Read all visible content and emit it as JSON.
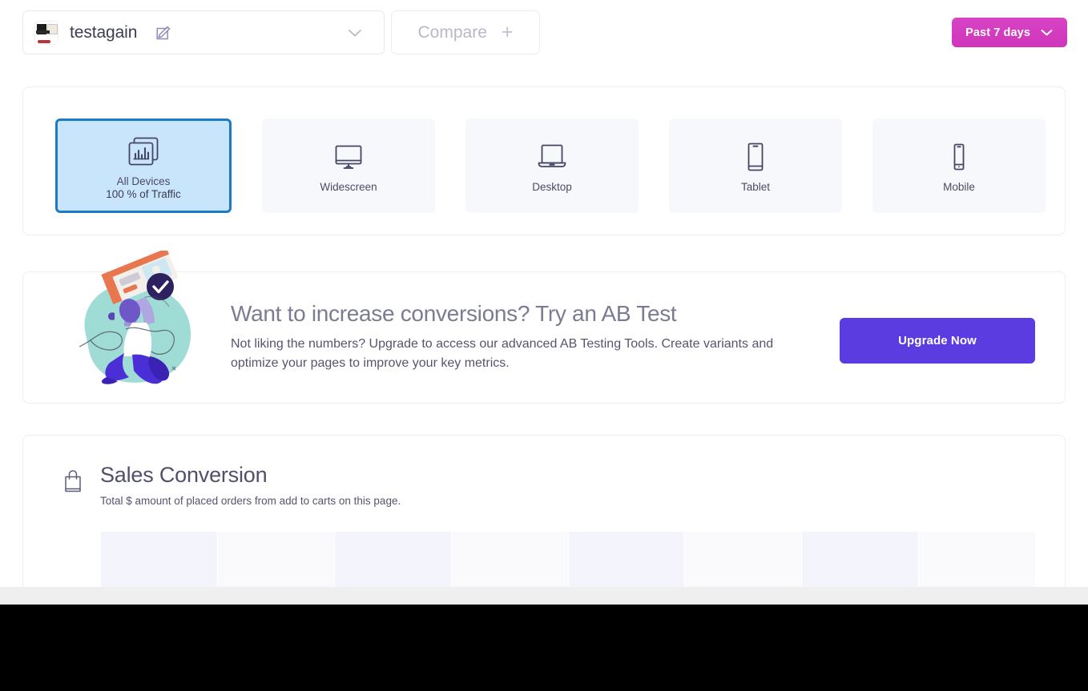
{
  "topbar": {
    "site_thumbnail_name": "site-favicon-thumbnail",
    "site_name": "testagain",
    "edit_icon": "edit-pencil-icon",
    "site_dropdown_icon": "chevron-down-icon",
    "compare_label": "Compare",
    "compare_plus": "+",
    "date_range_label": "Past 7 days",
    "date_range_icon": "chevron-down-icon",
    "date_range_color": "#d63bc2"
  },
  "devices": {
    "selected_index": 0,
    "selected_border_color": "#1f7ac4",
    "selected_background_color": "#c9e5fb",
    "tile_background_color": "#f6f8fc",
    "items": [
      {
        "label": "All Devices",
        "sublabel": "100 % of Traffic",
        "icon": "stacked-bar-chart-icon"
      },
      {
        "label": "Widescreen",
        "sublabel": "",
        "icon": "monitor-icon"
      },
      {
        "label": "Desktop",
        "sublabel": "",
        "icon": "laptop-icon"
      },
      {
        "label": "Tablet",
        "sublabel": "",
        "icon": "tablet-icon"
      },
      {
        "label": "Mobile",
        "sublabel": "",
        "icon": "mobile-phone-icon"
      }
    ]
  },
  "promo": {
    "illustration_name": "ab-test-person-illustration",
    "title": "Want to increase conversions? Try an AB Test",
    "description": "Not liking the numbers? Upgrade to access our advanced AB Testing Tools. Create variants and optimize your pages to improve your key metrics.",
    "button_label": "Upgrade Now",
    "button_color": "#5b3ce0"
  },
  "sales": {
    "icon": "shopping-bag-icon",
    "title": "Sales Conversion",
    "subtitle": "Total $ amount of placed orders from add to carts on this page.",
    "loading": true,
    "skeleton_columns": 8,
    "skeleton_colors": [
      "#f4f5fc",
      "#fafafc",
      "#f4f5fc",
      "#fafafc",
      "#f4f5fc",
      "#fafafc",
      "#f4f5fc",
      "#fafafc"
    ]
  }
}
